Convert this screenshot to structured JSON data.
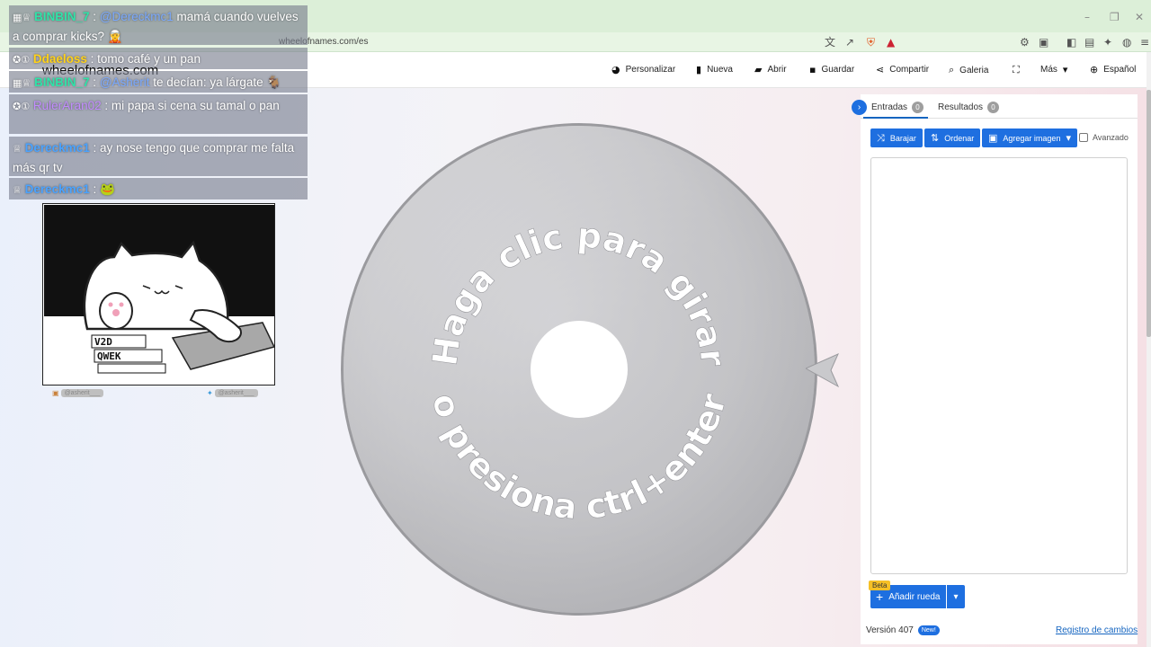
{
  "browser": {
    "url": "wheelofnames.com/es",
    "window_controls": [
      "–",
      "❐",
      "✕"
    ]
  },
  "navbar": {
    "items": [
      {
        "icon": "palette-icon",
        "glyph": "🎨",
        "label": "Personalizar"
      },
      {
        "icon": "file-icon",
        "glyph": "📄",
        "label": "Nueva"
      },
      {
        "icon": "folder-icon",
        "glyph": "📂",
        "label": "Abrir"
      },
      {
        "icon": "save-icon",
        "glyph": "💾",
        "label": "Guardar"
      },
      {
        "icon": "share-icon",
        "glyph": "⤴",
        "label": "Compartir"
      },
      {
        "icon": "search-icon",
        "glyph": "🔍",
        "label": "Galeria"
      },
      {
        "icon": "fullscreen-icon",
        "glyph": "⛶",
        "label": ""
      },
      {
        "icon": "more-icon",
        "glyph": "▾",
        "label": "Más"
      },
      {
        "icon": "globe-icon",
        "glyph": "🌐",
        "label": "Español"
      }
    ]
  },
  "wheel": {
    "top_text": "Haga clic para girar",
    "bottom_text": "o presiona ctrl+enter",
    "colors": {
      "fill": "#c4c4c8",
      "center": "#ffffff",
      "text": "#ffffff"
    }
  },
  "sidebar": {
    "tabs": [
      {
        "label": "Entradas",
        "count": "0"
      },
      {
        "label": "Resultados",
        "count": "0"
      }
    ],
    "buttons": {
      "shuffle": "Barajar",
      "sort": "Ordenar",
      "add_image": "Agregar imagen"
    },
    "advanced_label": "Avanzado",
    "beta_label": "Beta",
    "add_wheel_label": "Añadir rueda",
    "version_label": "Versión 407",
    "new_badge": "New!",
    "changelog_label": "Registro de cambios",
    "accent": "#1e6fe0"
  },
  "chat": {
    "messages": [
      {
        "user": "BINBIN_7",
        "mention": "@Dereckmc1",
        "text": " mamá cuando vuelves a comprar kicks? 🧝"
      },
      {
        "user": "Ddaeloss",
        "mention": "",
        "text": " : tomo café y un pan"
      },
      {
        "user": "BINBIN_7",
        "mention": "@Asherit",
        "text": " te decían: ya lárgate 🐐"
      },
      {
        "user": "RulerAran02",
        "mention": "",
        "text": " : mi papa si cena su tamal o pan"
      },
      {
        "user": "Dereckmc1",
        "mention": "",
        "text": " : ay nose tengo que comprar me falta más qr tv"
      },
      {
        "user": "Dereckmc1",
        "mention": "",
        "text": " : 🐸"
      }
    ],
    "faded_url": "wheelofnames.com"
  },
  "cam": {
    "keys_row1": "V2D",
    "keys_row2": "QWEK",
    "social_left": "@asherit___",
    "social_right": "@asherit___"
  }
}
